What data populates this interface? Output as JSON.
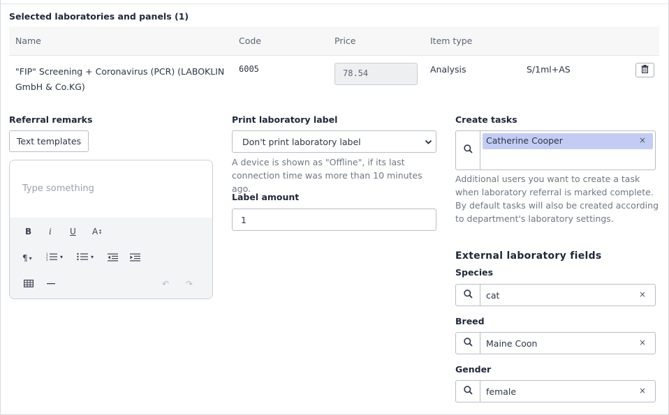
{
  "section": {
    "title": "Selected laboratories and panels (1)"
  },
  "table": {
    "headers": {
      "name": "Name",
      "code": "Code",
      "price": "Price",
      "item_type": "Item type"
    },
    "rows": [
      {
        "name": "\"FIP\" Screening + Coronavirus (PCR) (LABOKLIN GmbH & Co.KG)",
        "code": "6005",
        "price": "78.54",
        "item_type": "Analysis",
        "sample": "S/1ml+AS"
      }
    ]
  },
  "referral": {
    "label": "Referral remarks",
    "templates_button": "Text templates",
    "editor_placeholder": "Type something"
  },
  "print_label": {
    "label": "Print laboratory label",
    "selected": "Don't print laboratory label",
    "help": "A device is shown as \"Offline\", if its last connection time was more than 10 minutes ago."
  },
  "label_amount": {
    "label": "Label amount",
    "value": "1"
  },
  "tasks": {
    "label": "Create tasks",
    "chips": [
      "Catherine Cooper"
    ],
    "help": "Additional users you want to create a task when laboratory referral is marked complete. By default tasks will also be created according to department's laboratory settings."
  },
  "external": {
    "title": "External laboratory fields",
    "species": {
      "label": "Species",
      "value": "cat"
    },
    "breed": {
      "label": "Breed",
      "value": "Maine Coon"
    },
    "gender": {
      "label": "Gender",
      "value": "female"
    }
  },
  "icons": {
    "trash": "trash-icon",
    "search": "search-icon",
    "clear": "clear-icon",
    "chevron": "chevron-down-icon"
  },
  "colors": {
    "chip_bg": "#c3cdf4",
    "border": "#b8bdc5"
  }
}
